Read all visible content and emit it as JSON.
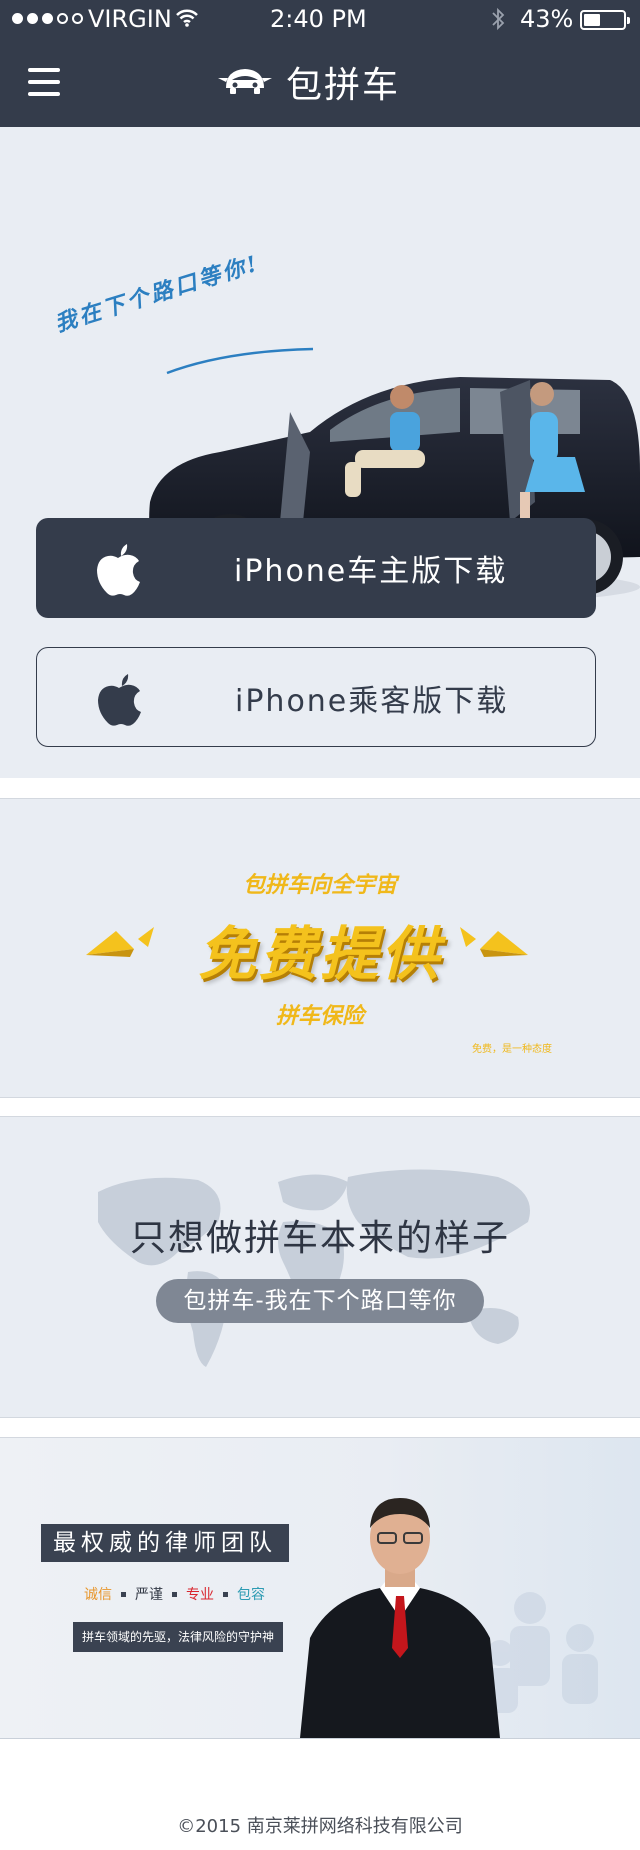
{
  "status_bar": {
    "carrier": "VIRGIN",
    "time": "2:40 PM",
    "battery": "43%",
    "battery_level": 0.43,
    "signal_filled": 3,
    "signal_total": 5,
    "icons": [
      "wifi-icon",
      "bluetooth-icon",
      "battery-icon"
    ]
  },
  "navbar": {
    "title": "包拼车",
    "icons": [
      "menu-icon",
      "car-logo-icon"
    ]
  },
  "hero": {
    "slogan": "我在下个路口等你!",
    "download_owner": "iPhone车主版下载",
    "download_passenger": "iPhone乘客版下载",
    "icon": "apple-icon"
  },
  "promo_free": {
    "top": "包拼车向全宇宙",
    "main": "免费提供",
    "sub": "拼车保险",
    "note": "免费，是一种态度"
  },
  "promo_map": {
    "title": "只想做拼车本来的样子",
    "pill": "包拼车-我在下个路口等你"
  },
  "promo_lawyer": {
    "title": "最权威的律师团队",
    "tags": [
      {
        "text": "诚信",
        "color": "#e8962b"
      },
      {
        "text": "严谨",
        "color": "#333a46"
      },
      {
        "text": "专业",
        "color": "#d9262e"
      },
      {
        "text": "包容",
        "color": "#2d9bb3"
      }
    ],
    "desc": "拼车领域的先驱，法律风险的守护神"
  },
  "footer": {
    "copyright": "©2015 南京莱拼网络科技有限公司"
  },
  "colors": {
    "primary": "#343c4b",
    "background": "#e9edf3",
    "accent_gold": "#f4c21d",
    "slogan_blue": "#2c7fc1"
  }
}
